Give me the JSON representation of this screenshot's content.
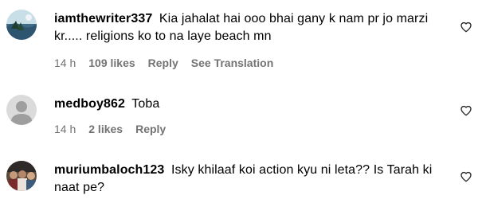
{
  "comments": [
    {
      "username": "iamthewriter337",
      "text": "Kia jahalat hai ooo bhai gany k nam pr jo marzi kr..... religions ko to na laye beach mn",
      "time": "14 h",
      "likes": "109 likes",
      "reply": "Reply",
      "translation": "See Translation",
      "avatar_icon": "landscape-photo-avatar"
    },
    {
      "username": "medboy862",
      "text": "Toba",
      "time": "14 h",
      "likes": "2 likes",
      "reply": "Reply",
      "avatar_icon": "default-user-avatar"
    },
    {
      "username": "muriumbaloch123",
      "text": "Isky khilaaf koi action kyu ni leta?? Is Tarah ki naat pe?",
      "avatar_icon": "crowd-photo-avatar"
    }
  ],
  "colors": {
    "meta_text": "#737373",
    "heart_stroke": "#262626"
  }
}
